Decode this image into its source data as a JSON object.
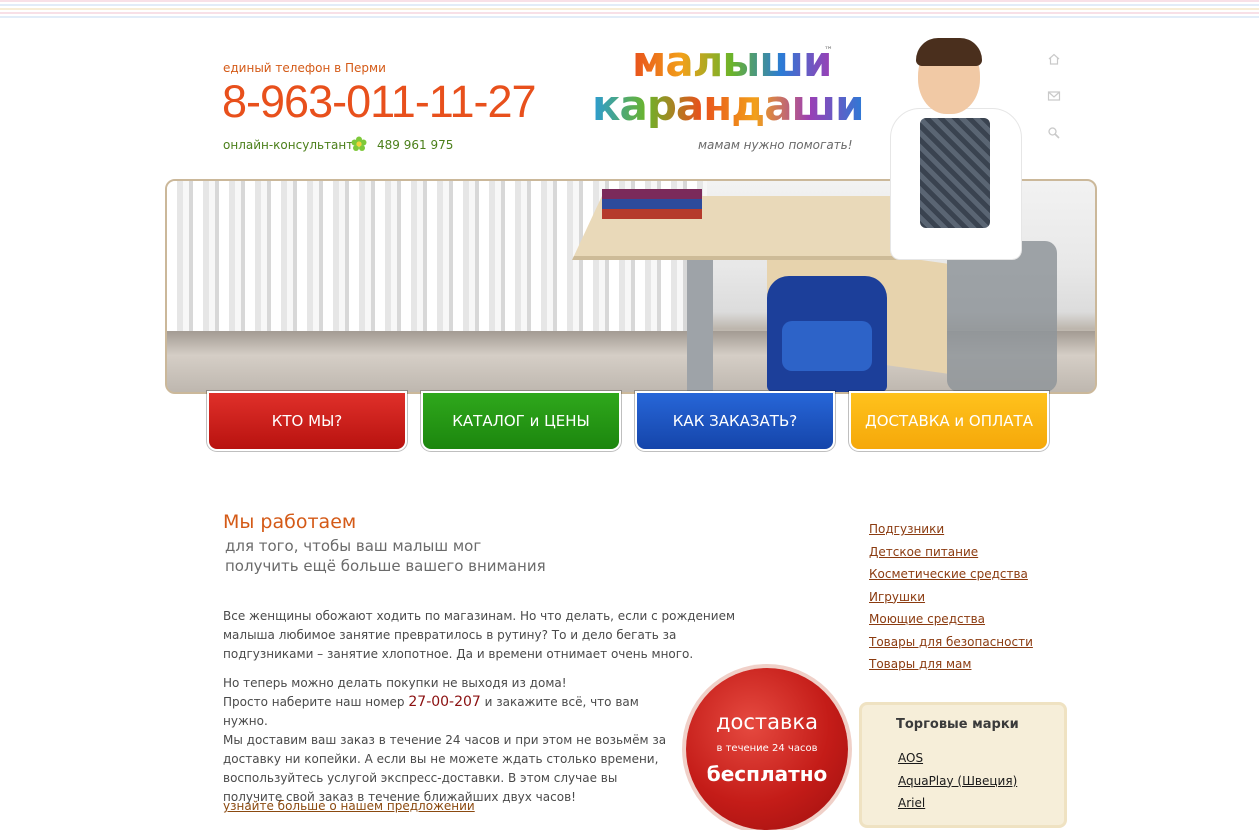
{
  "header": {
    "phone_caption": "единый телефон в Перми",
    "phone_number": "8-963-011-11-27",
    "consult_label": "онлайн-консультант",
    "icq_number": "489 961 975",
    "logo_line1": "малыши",
    "logo_line2": "карандаши",
    "logo_tm": "™",
    "slogan": "мамам нужно помогать!",
    "util_icons": [
      "home-icon",
      "mail-icon",
      "search-icon"
    ]
  },
  "nav": {
    "items": [
      {
        "label": "КТО МЫ?",
        "color": "#c41c18"
      },
      {
        "label": "КАТАЛОГ и ЦЕНЫ",
        "color": "#1f8e10"
      },
      {
        "label": "КАК ЗАКАЗАТЬ?",
        "color": "#1a4fb8"
      },
      {
        "label": "ДОСТАВКА и ОПЛАТА",
        "color": "#f7ae0c"
      }
    ]
  },
  "main": {
    "headline": "Мы работаем",
    "subhead_line1": "для того, чтобы ваш малыш мог",
    "subhead_line2": "получить ещё больше вашего внимания",
    "para1": "Все женщины обожают ходить по магазинам. Но что делать, если с рождением малыша любимое занятие превратилось в рутину? То и дело бегать за подгузниками – занятие хлопотное. Да и времени отнимает очень много.",
    "para2_line1": "Но теперь можно делать покупки не выходя из дома!",
    "para2_line2_a": "Просто наберите наш номер ",
    "para2_phone": "27-00-207",
    "para2_line2_b": " и закажите всё, что вам нужно.",
    "para2_rest": "Мы доставим ваш заказ в течение 24 часов и при этом не возьмём за доставку ни копейки. А если вы не можете ждать столько времени, воспользуйтесь услугой экспресс-доставки. В этом случае вы получите свой заказ в течение ближайших двух часов!",
    "more_link": "узнайте больше о нашем предложении"
  },
  "promo": {
    "top": "доставка",
    "middle": "в течение 24 часов",
    "bottom": "бесплатно"
  },
  "categories": [
    "Подгузники",
    "Детское питание",
    "Косметические средства",
    "Игрушки",
    "Моющие средства",
    "Товары для безопасности",
    "Товары для мам"
  ],
  "brands": {
    "title": "Торговые марки",
    "items": [
      "AOS",
      "AquaPlay (Швеция)",
      "Ariel"
    ]
  }
}
